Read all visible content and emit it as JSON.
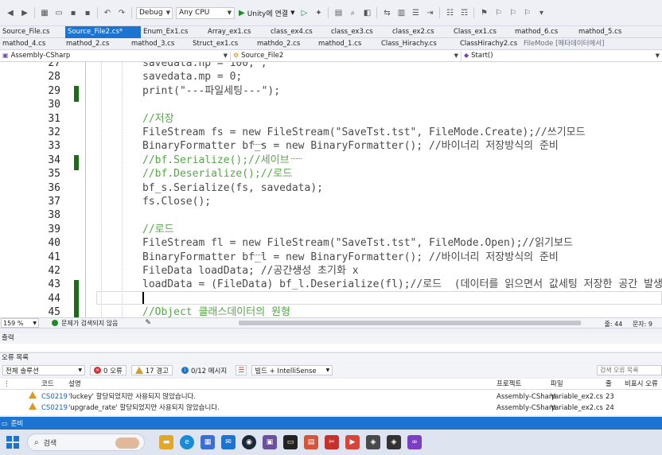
{
  "toolbar": {
    "config": "Debug",
    "platform": "Any CPU",
    "run_label": "Unity에 연결"
  },
  "tabs_row1": [
    {
      "label": "Source_File.cs",
      "active": false,
      "muted": false
    },
    {
      "label": "Source_File2.cs*",
      "active": true,
      "muted": false
    },
    {
      "label": "Enum_Ex1.cs",
      "active": false,
      "muted": false
    },
    {
      "label": "Array_ex1.cs",
      "active": false,
      "muted": false
    },
    {
      "label": "class_ex4.cs",
      "active": false,
      "muted": false
    },
    {
      "label": "class_ex3.cs",
      "active": false,
      "muted": false
    },
    {
      "label": "class_ex2.cs",
      "active": false,
      "muted": false
    },
    {
      "label": "Class_ex1.cs",
      "active": false,
      "muted": false
    },
    {
      "label": "mathod_6.cs",
      "active": false,
      "muted": false
    },
    {
      "label": "mathod_5.cs",
      "active": false,
      "muted": false
    }
  ],
  "tabs_row2": [
    {
      "label": "mathod_4.cs",
      "active": false,
      "muted": false
    },
    {
      "label": "mathod_2.cs",
      "active": false,
      "muted": false
    },
    {
      "label": "mathod_3.cs",
      "active": false,
      "muted": false
    },
    {
      "label": "Struct_ex1.cs",
      "active": false,
      "muted": false
    },
    {
      "label": "mathdo_2.cs",
      "active": false,
      "muted": false
    },
    {
      "label": "mathod_1.cs",
      "active": false,
      "muted": false
    },
    {
      "label": "Class_Hirachy.cs",
      "active": false,
      "muted": false
    },
    {
      "label": "ClassHirachy2.cs",
      "active": false,
      "muted": false
    },
    {
      "label": "FileMode [메타데이터에서]",
      "active": false,
      "muted": true
    }
  ],
  "nav": {
    "project": "Assembly-CSharp",
    "type": "Source_File2",
    "member": "Start()"
  },
  "editor": {
    "lines": [
      {
        "num": "27",
        "text": "savedata.hp = 100; ;",
        "kind": "code"
      },
      {
        "num": "28",
        "text": "savedata.mp = 0;",
        "kind": "code"
      },
      {
        "num": "29",
        "text": "print(\"---파일세팅---\");",
        "kind": "code"
      },
      {
        "num": "30",
        "text": "",
        "kind": "code"
      },
      {
        "num": "31",
        "text": "//저장",
        "kind": "comment"
      },
      {
        "num": "32",
        "text": "FileStream fs = new FileStream(\"SaveTst.tst\", FileMode.Create);//쓰기모드",
        "kind": "code"
      },
      {
        "num": "33",
        "text": "BinaryFormatter bf_s = new BinaryFormatter(); //바이너리 저장방식의 준비",
        "kind": "code"
      },
      {
        "num": "34",
        "text": "//bf.Serialize();//세이브",
        "kind": "comment"
      },
      {
        "num": "35",
        "text": "//bf.Deserialize();//로드",
        "kind": "comment"
      },
      {
        "num": "36",
        "text": "bf_s.Serialize(fs, savedata);",
        "kind": "code"
      },
      {
        "num": "37",
        "text": "fs.Close();",
        "kind": "code"
      },
      {
        "num": "38",
        "text": "",
        "kind": "code"
      },
      {
        "num": "39",
        "text": "//로드",
        "kind": "comment"
      },
      {
        "num": "40",
        "text": "FileStream fl = new FileStream(\"SaveTst.tst\", FileMode.Open);//읽기보드",
        "kind": "code"
      },
      {
        "num": "41",
        "text": "BinaryFormatter bf_l = new BinaryFormatter(); //바이너리 저장방식의 준비",
        "kind": "code"
      },
      {
        "num": "42",
        "text": "FileData loadData; //공간생성 초기화 x",
        "kind": "code"
      },
      {
        "num": "43",
        "text": "loadData = (FileData) bf_l.Deserialize(fl);//로드  (데이터를 읽으면서 값세팅 저장한 공간 발생",
        "kind": "code"
      },
      {
        "num": "44",
        "text": "",
        "kind": "code"
      },
      {
        "num": "45",
        "text": "//Object 클래스데이터의 원형",
        "kind": "comment"
      }
    ]
  },
  "status": {
    "zoom": "159 %",
    "issues": "문제가 검색되지 않음",
    "line": "줄: 44",
    "char": "문자: 9"
  },
  "output_panel": {
    "title": "출력"
  },
  "error_list": {
    "title": "오류 목록",
    "scope": "전체 솔루션",
    "errors": "0 오류",
    "warnings": "17 경고",
    "messages": "0/12 메시지",
    "build_filter": "빌드 + IntelliSense",
    "search_placeholder": "검색 오류 목록",
    "columns": {
      "code": "코드",
      "desc": "설명",
      "project": "프로젝트",
      "file": "파일",
      "line": "줄",
      "suppress": "비표시 오류"
    },
    "rows": [
      {
        "code": "CS0219",
        "desc": "'luckey' 할당되었지만 사용되지 않았습니다.",
        "project": "Assembly-CSharp",
        "file": "Variable_ex2.cs",
        "line": "23"
      },
      {
        "code": "CS0219",
        "desc": "'upgrade_rate' 할당되었지만 사용되지 않았습니다.",
        "project": "Assembly-CSharp",
        "file": "Variable_ex2.cs",
        "line": "24"
      }
    ]
  },
  "vs_status": {
    "text": "준비"
  },
  "taskbar": {
    "search": "검색"
  },
  "colors": {
    "accent": "#1c73d0",
    "comment": "#57a64a",
    "warning": "#d69b2a",
    "error": "#d13438"
  }
}
